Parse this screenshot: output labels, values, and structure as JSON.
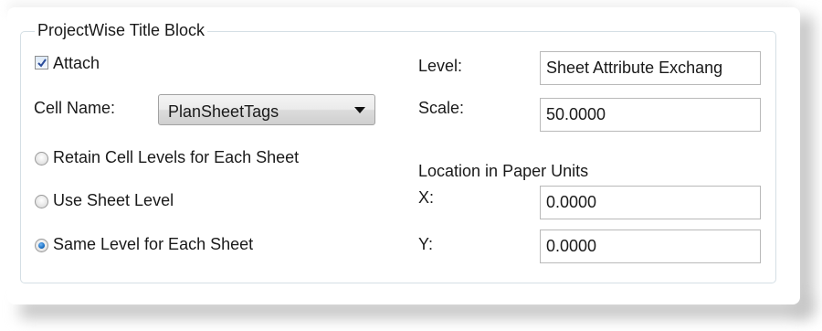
{
  "group": {
    "title": "ProjectWise Title Block"
  },
  "attach": {
    "label": "Attach",
    "checked": true
  },
  "cell_name": {
    "label": "Cell Name:",
    "selected": "PlanSheetTags"
  },
  "level_options": {
    "retain": "Retain Cell Levels for Each Sheet",
    "use_sheet": "Use Sheet Level",
    "same": "Same Level for Each Sheet",
    "selected": "same"
  },
  "level": {
    "label": "Level:",
    "value": "Sheet Attribute Exchang"
  },
  "scale": {
    "label": "Scale:",
    "value": "50.0000"
  },
  "location": {
    "heading": "Location in Paper Units",
    "x_label": "X:",
    "x_value": "0.0000",
    "y_label": "Y:",
    "y_value": "0.0000"
  },
  "colors": {
    "groupbox_border": "#d5dfe5",
    "radio_selected": "#1b6fc2",
    "checkbox_check": "#2b4c9a"
  }
}
